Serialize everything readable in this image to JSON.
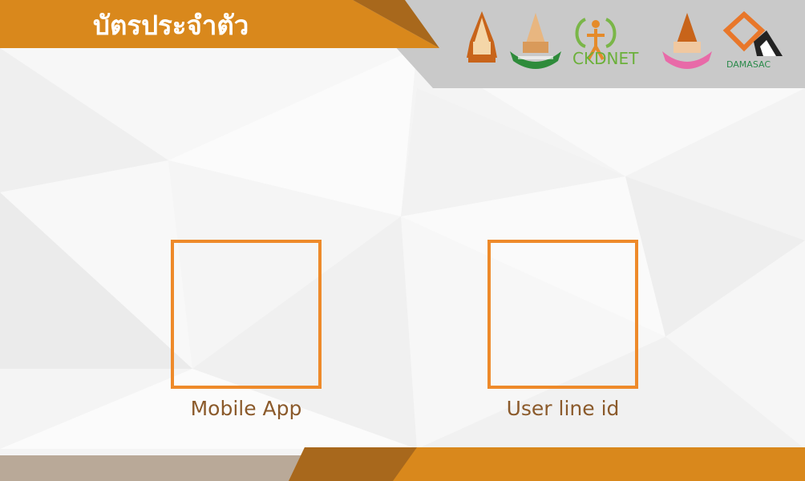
{
  "card": {
    "title": "บัตรประจำตัว"
  },
  "logos": [
    {
      "name": "university-seal-logo",
      "text": ""
    },
    {
      "name": "medicine-faculty-logo",
      "text": ""
    },
    {
      "name": "ckdnet-logo",
      "text": "CKDNET"
    },
    {
      "name": "hospital-seal-logo",
      "text": ""
    },
    {
      "name": "damasac-logo",
      "text": "DAMASAC"
    }
  ],
  "qr_codes": [
    {
      "caption": "Mobile App"
    },
    {
      "caption": "User line id"
    }
  ],
  "colors": {
    "accent_orange": "#d9881c",
    "dark_orange": "#a8681c",
    "gray_band": "#c9c9c9",
    "frame_orange": "#ee8a2a",
    "caption_brown": "#8b5a2b"
  }
}
